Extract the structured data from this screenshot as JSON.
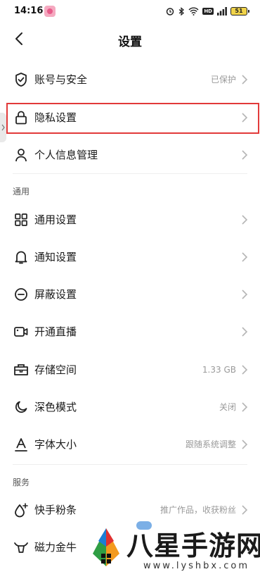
{
  "status_bar": {
    "time": "14:16",
    "battery": "51"
  },
  "header": {
    "title": "设置"
  },
  "rows_top": [
    {
      "label": "账号与安全",
      "value": "已保护",
      "icon": "shield-check-icon"
    },
    {
      "label": "隐私设置",
      "value": "",
      "icon": "lock-icon"
    },
    {
      "label": "个人信息管理",
      "value": "",
      "icon": "person-icon"
    }
  ],
  "sections": {
    "general": "通用",
    "services": "服务"
  },
  "rows_general": [
    {
      "label": "通用设置",
      "value": "",
      "icon": "grid-icon"
    },
    {
      "label": "通知设置",
      "value": "",
      "icon": "bell-icon"
    },
    {
      "label": "屏蔽设置",
      "value": "",
      "icon": "block-icon"
    },
    {
      "label": "开通直播",
      "value": "",
      "icon": "video-camera-icon"
    },
    {
      "label": "存储空间",
      "value": "1.33 GB",
      "icon": "storage-box-icon"
    },
    {
      "label": "深色模式",
      "value": "关闭",
      "icon": "moon-icon"
    },
    {
      "label": "字体大小",
      "value": "跟随系统调整",
      "icon": "font-size-icon"
    }
  ],
  "rows_services": [
    {
      "label": "快手粉条",
      "value": "推广作品，收获粉丝",
      "icon": "drop-plus-icon"
    },
    {
      "label": "磁力金牛",
      "value": "",
      "icon": "bull-icon"
    }
  ],
  "watermark": {
    "title": "八星手游网",
    "url": "www.lyshbx.com"
  },
  "colors": {
    "highlight": "#e23a3a",
    "value_text": "#9a9a9a"
  }
}
